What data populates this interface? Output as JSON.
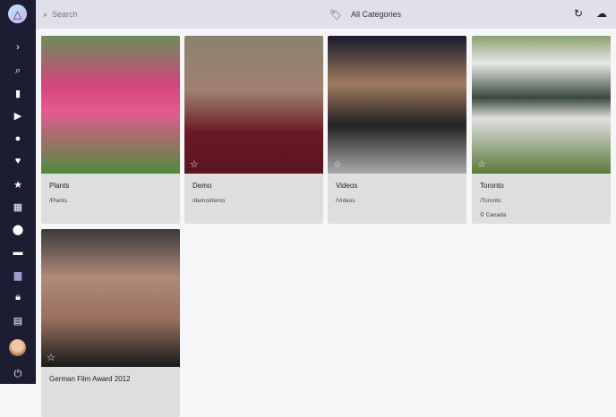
{
  "topbar": {
    "search_placeholder": "Search",
    "category": "All Categories"
  },
  "nav": [
    "expand",
    "search",
    "bookmark",
    "play",
    "person",
    "heart",
    "star",
    "calendar",
    "place",
    "label",
    "folder",
    "lock",
    "library",
    "avatar",
    "power"
  ],
  "cards": [
    {
      "title": "Plants",
      "path": "/Plants"
    },
    {
      "title": "Demo",
      "path": "/demo/demo"
    },
    {
      "title": "Videos",
      "path": "/Videos"
    },
    {
      "title": "Toronto",
      "path": "/Toronto",
      "location": "Canada"
    },
    {
      "title": "German Film Award 2012",
      "path": ""
    }
  ]
}
